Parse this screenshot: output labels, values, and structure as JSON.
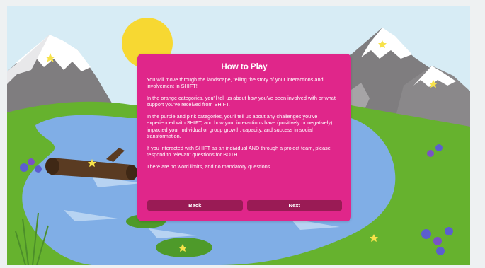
{
  "dialog": {
    "title": "How to Play",
    "paragraphs": [
      "You will move through the landscape, telling the story of your interactions and involvement in SHIFT!",
      "In the orange categories, you'll tell us about how you've been involved with or what support you've received from SHIFT.",
      "In the purple and pink categories, you'll tell us about any challenges you've experienced with SHIFT, and how your interactions have (positively or negatively) impacted your individual or group growth, capacity, and success in social transformation.",
      "If you interacted with SHIFT as an individual AND through a project team, please respond to relevant questions for BOTH.",
      "There are no word limits, and no mandatory questions."
    ],
    "back_label": "Back",
    "next_label": "Next"
  },
  "colors": {
    "dialog_bg": "#e0268a",
    "button_bg": "#9a1b55",
    "sky": "#d7ecf5",
    "grass": "#66b22e",
    "lake": "#80aee6",
    "sun": "#f7d832"
  }
}
